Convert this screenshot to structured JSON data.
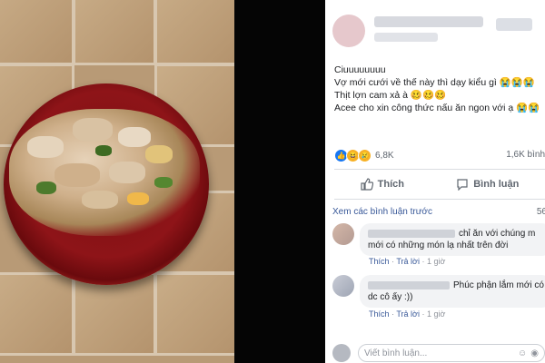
{
  "post": {
    "lines": [
      "Ciuuuuuuuu",
      "Vợ mới cưới về thế này thì dạy kiểu gì 😭😭😭",
      "Thịt lợn cam xả à 🥴🥴🥴",
      "Acee cho xin công thức nấu ăn ngon với ạ 😭😭"
    ],
    "reaction_count": "6,8K",
    "share_count": "1,6K bình"
  },
  "actions": {
    "like_label": "Thích",
    "comment_label": "Bình luận"
  },
  "comments_section": {
    "view_more": "Xem các bình luận trước",
    "count_tail": "56",
    "comments": [
      {
        "line1": "chỉ ăn với chúng m",
        "line2": "mới có những món lạ nhất trên đời",
        "like": "Thích",
        "reply": "Trả lời",
        "time": "1 giờ"
      },
      {
        "line1": "Phúc phận lắm mới có",
        "line2": "dc cô ấy :))",
        "like": "Thích",
        "reply": "Trả lời",
        "time": "1 giờ"
      }
    ]
  },
  "composer": {
    "placeholder": "Viết bình luận..."
  },
  "colors": {
    "link": "#385898",
    "like_blue": "#1877f2",
    "bowl_red": "#8e1418"
  }
}
